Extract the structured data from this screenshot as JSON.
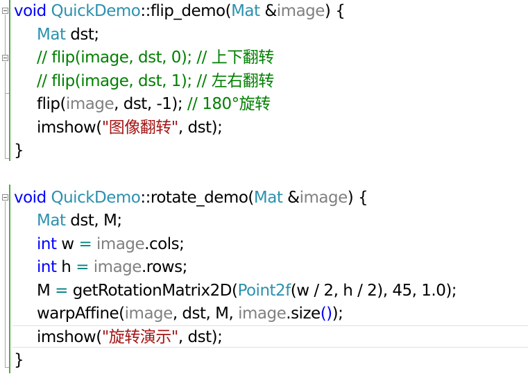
{
  "colors": {
    "keyword": "#0000ff",
    "type": "#2b91af",
    "comment": "#008000",
    "string": "#a31515",
    "parameter": "#808080",
    "background": "#ffffff",
    "change_bar": "#57a64a"
  },
  "icons": {
    "fold": "collapse-minus-icon"
  },
  "code": {
    "flip": {
      "sig_void": "void",
      "sig_class": "QuickDemo",
      "sig_scope": "::",
      "sig_func": "flip_demo(",
      "sig_type": "Mat",
      "sig_amp": " &",
      "sig_param": "image",
      "sig_close": ") {",
      "l1_type": "Mat",
      "l1_rest": " dst;",
      "l2_comment": "// flip(image, dst, 0); // 上下翻转",
      "l3_comment": "// flip(image, dst, 1); // 左右翻转",
      "l4_func": "flip(",
      "l4_param": "image",
      "l4_rest": ", dst, -1); ",
      "l4_comment": "// 180°旋转",
      "l5_func": "imshow(",
      "l5_str": "\"图像翻转\"",
      "l5_rest": ", dst);",
      "close": "}"
    },
    "rotate": {
      "sig_void": "void",
      "sig_class": "QuickDemo",
      "sig_scope": "::",
      "sig_func": "rotate_demo(",
      "sig_type": "Mat",
      "sig_amp": " &",
      "sig_param": "image",
      "sig_close": ") {",
      "l1_type": "Mat",
      "l1_rest": " dst, M;",
      "l2_kw": "int",
      "l2_a": " w ",
      "l2_op": "=",
      "l2_sp": " ",
      "l2_param": "image",
      "l2_rest": ".cols;",
      "l3_kw": "int",
      "l3_a": " h ",
      "l3_op": "=",
      "l3_sp": " ",
      "l3_param": "image",
      "l3_rest": ".rows;",
      "l4_a": "M ",
      "l4_op": "=",
      "l4_b": " getRotationMatrix2D(",
      "l4_type": "Point2f",
      "l4_rest": "(w / 2, h / 2), 45, 1.0);",
      "l5_func": "warpAffine(",
      "l5_param": "image",
      "l5_mid": ", dst, M, ",
      "l5_param2": "image",
      "l5_size": ".size",
      "l5_parens": "()",
      "l5_end": ");",
      "l6_func": "imshow(",
      "l6_str": "\"旋转演示\"",
      "l6_rest": ", dst);",
      "close": "}"
    }
  }
}
